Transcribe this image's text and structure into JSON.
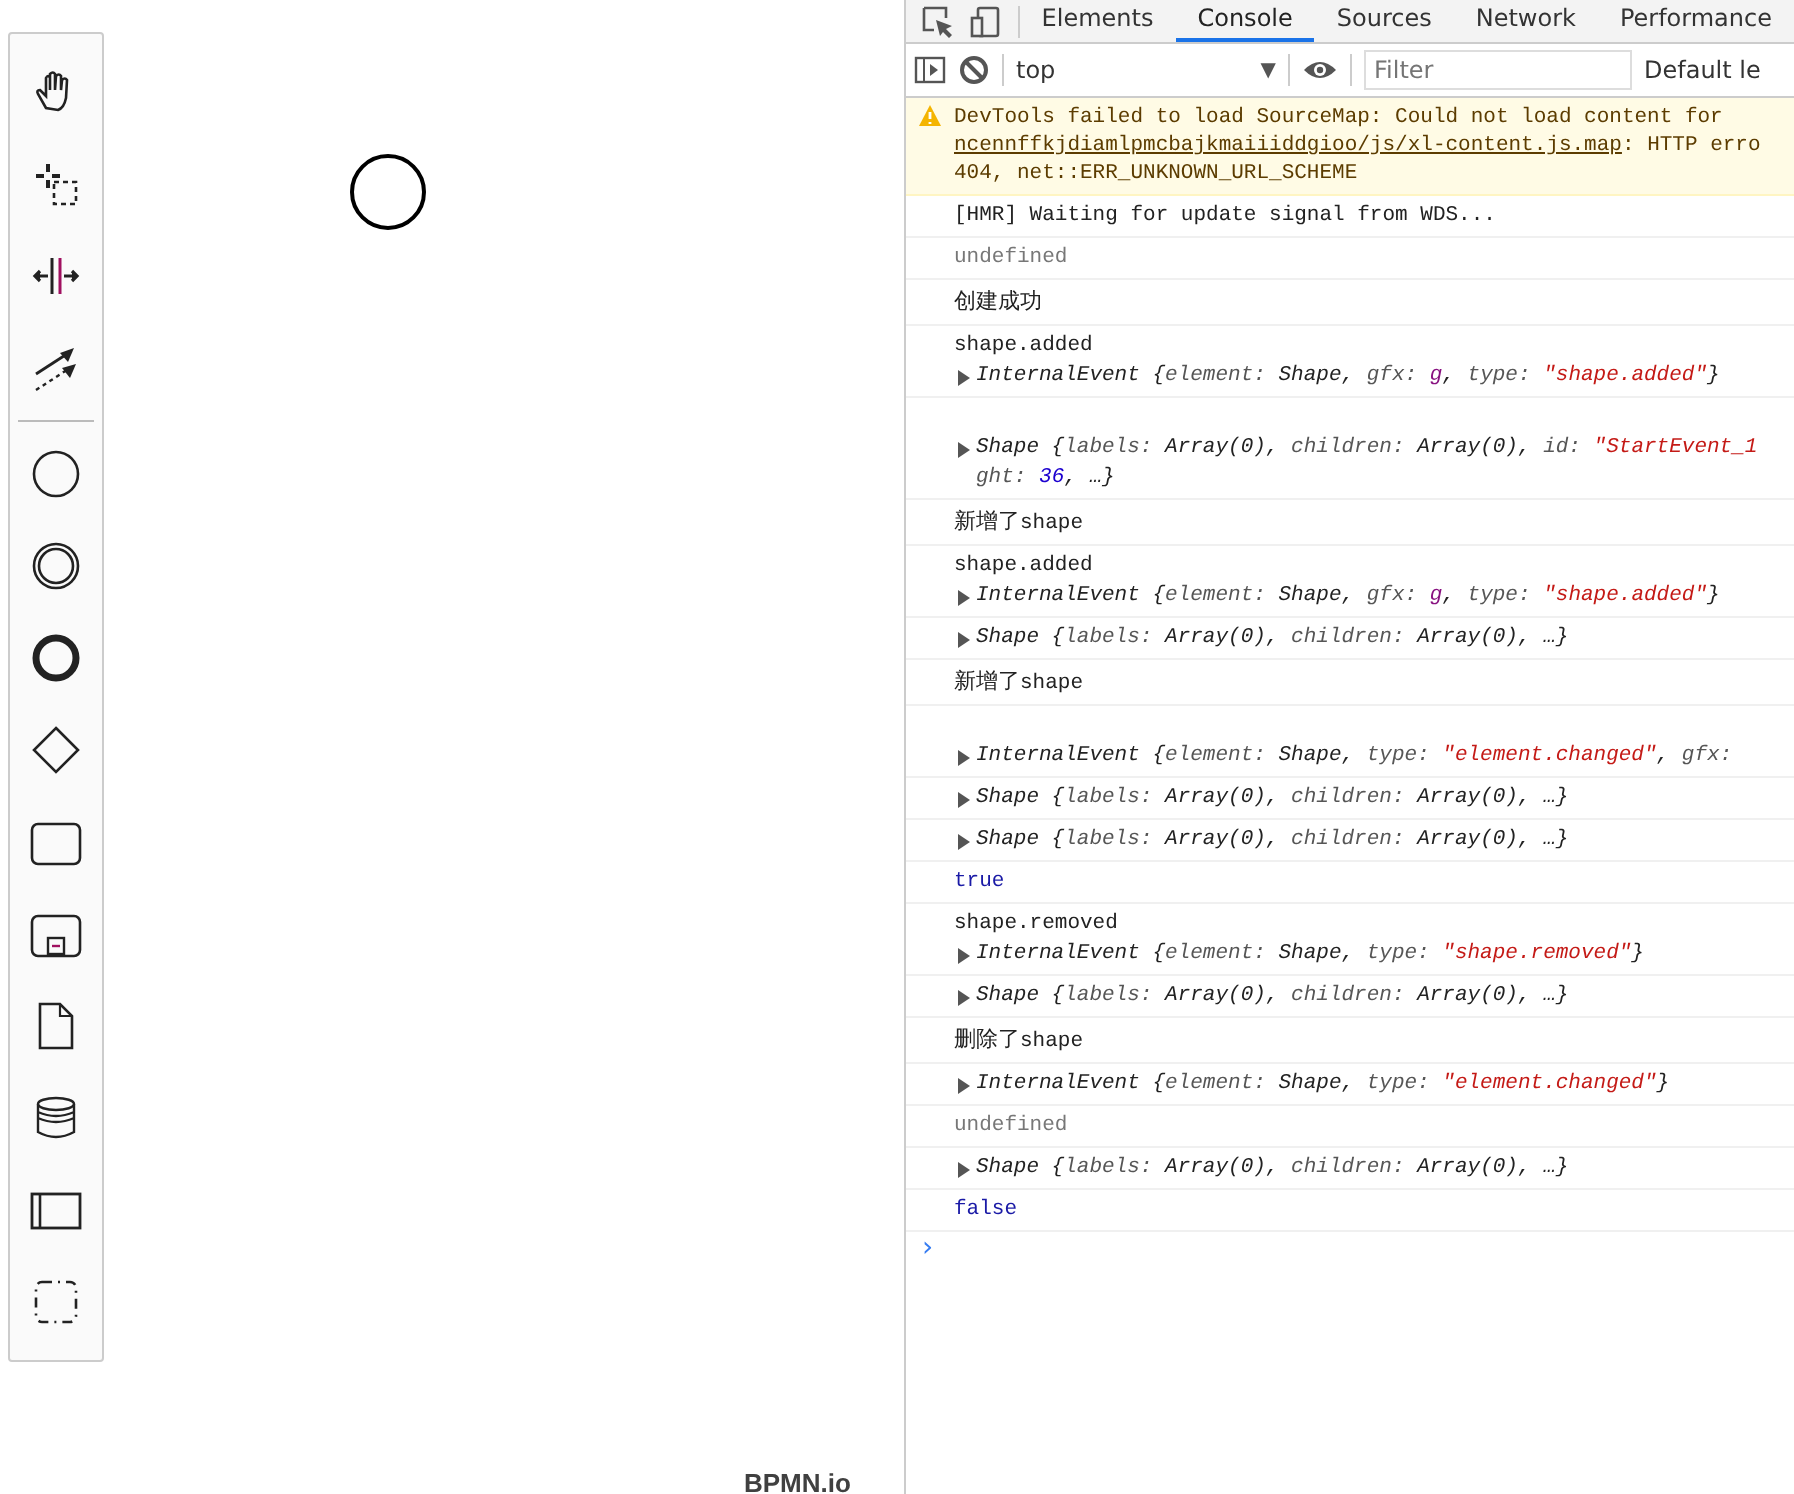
{
  "palette": {
    "tools": [
      {
        "kind": "hand"
      },
      {
        "kind": "lasso"
      },
      {
        "kind": "space"
      },
      {
        "kind": "connect"
      },
      {
        "kind": "separator"
      },
      {
        "kind": "start"
      },
      {
        "kind": "intermediate"
      },
      {
        "kind": "end"
      },
      {
        "kind": "gateway"
      },
      {
        "kind": "task"
      },
      {
        "kind": "subprocess"
      },
      {
        "kind": "data-object"
      },
      {
        "kind": "data-store"
      },
      {
        "kind": "pool"
      },
      {
        "kind": "group"
      }
    ]
  },
  "canvas": {
    "shapes": [
      {
        "kind": "start"
      }
    ],
    "watermark": "BPMN.io"
  },
  "devtools": {
    "tabs": [
      {
        "label": "Elements",
        "selected": false
      },
      {
        "label": "Console",
        "selected": true
      },
      {
        "label": "Sources",
        "selected": false
      },
      {
        "label": "Network",
        "selected": false
      },
      {
        "label": "Performance",
        "selected": false
      }
    ],
    "toolbar": {
      "context": "top",
      "dropdown_glyph": "▼",
      "filter_placeholder": "Filter",
      "levels": "Default le"
    },
    "warning": {
      "lines": [
        [
          {
            "kind": "plain",
            "t": "DevTools failed to load SourceMap: Could not load content for"
          }
        ],
        [
          {
            "kind": "link",
            "t": "ncennffkjdiamlpmcbajkmaiiiddgioo/js/xl-content.js.map"
          },
          {
            "kind": "plain",
            "t": ": HTTP erro"
          }
        ],
        [
          {
            "kind": "plain",
            "t": "404, net::ERR_UNKNOWN_URL_SCHEME"
          }
        ]
      ]
    },
    "messages": [
      {
        "lines": [
          {
            "toggle": false,
            "parts": [
              {
                "kind": "plain",
                "t": "[HMR] Waiting for update signal from WDS..."
              }
            ]
          }
        ]
      },
      {
        "lines": [
          {
            "toggle": false,
            "parts": [
              {
                "kind": "dim",
                "t": "undefined"
              }
            ]
          }
        ]
      },
      {
        "lines": [
          {
            "toggle": false,
            "parts": [
              {
                "kind": "plain",
                "t": "创建成功"
              }
            ]
          }
        ]
      },
      {
        "lines": [
          {
            "toggle": false,
            "parts": [
              {
                "kind": "plain",
                "t": "shape.added"
              }
            ]
          },
          {
            "toggle": true,
            "parts": [
              {
                "kind": "obj",
                "t": "InternalEvent {"
              },
              {
                "kind": "key",
                "t": "element: "
              },
              {
                "kind": "obj",
                "t": "Shape, "
              },
              {
                "kind": "key",
                "t": "gfx: "
              },
              {
                "kind": "sym",
                "t": "g"
              },
              {
                "kind": "obj",
                "t": ", "
              },
              {
                "kind": "key",
                "t": "type: "
              },
              {
                "kind": "str",
                "t": "\"shape.added\""
              },
              {
                "kind": "obj",
                "t": "}"
              }
            ]
          }
        ]
      },
      {
        "spacer": true,
        "lines": [
          {
            "toggle": true,
            "parts": [
              {
                "kind": "obj",
                "t": "Shape {"
              },
              {
                "kind": "key",
                "t": "labels: "
              },
              {
                "kind": "obj",
                "t": "Array(0), "
              },
              {
                "kind": "key",
                "t": "children: "
              },
              {
                "kind": "obj",
                "t": "Array(0), "
              },
              {
                "kind": "key",
                "t": "id: "
              },
              {
                "kind": "str",
                "t": "\"StartEvent_1"
              }
            ]
          },
          {
            "toggle": false,
            "parts": [
              {
                "kind": "key",
                "t": "ght: "
              },
              {
                "kind": "num",
                "t": "36"
              },
              {
                "kind": "obj",
                "t": ", …}"
              }
            ]
          }
        ]
      },
      {
        "lines": [
          {
            "toggle": false,
            "parts": [
              {
                "kind": "plain",
                "t": "新增了shape"
              }
            ]
          }
        ]
      },
      {
        "lines": [
          {
            "toggle": false,
            "parts": [
              {
                "kind": "plain",
                "t": "shape.added"
              }
            ]
          },
          {
            "toggle": true,
            "parts": [
              {
                "kind": "obj",
                "t": "InternalEvent {"
              },
              {
                "kind": "key",
                "t": "element: "
              },
              {
                "kind": "obj",
                "t": "Shape, "
              },
              {
                "kind": "key",
                "t": "gfx: "
              },
              {
                "kind": "sym",
                "t": "g"
              },
              {
                "kind": "obj",
                "t": ", "
              },
              {
                "kind": "key",
                "t": "type: "
              },
              {
                "kind": "str",
                "t": "\"shape.added\""
              },
              {
                "kind": "obj",
                "t": "}"
              }
            ]
          }
        ]
      },
      {
        "lines": [
          {
            "toggle": true,
            "parts": [
              {
                "kind": "obj",
                "t": "Shape {"
              },
              {
                "kind": "key",
                "t": "labels: "
              },
              {
                "kind": "obj",
                "t": "Array(0), "
              },
              {
                "kind": "key",
                "t": "children: "
              },
              {
                "kind": "obj",
                "t": "Array(0), …}"
              }
            ]
          }
        ]
      },
      {
        "lines": [
          {
            "toggle": false,
            "parts": [
              {
                "kind": "plain",
                "t": "新增了shape"
              }
            ]
          }
        ]
      },
      {
        "spacer": true,
        "lines": [
          {
            "toggle": true,
            "parts": [
              {
                "kind": "obj",
                "t": "InternalEvent {"
              },
              {
                "kind": "key",
                "t": "element: "
              },
              {
                "kind": "obj",
                "t": "Shape, "
              },
              {
                "kind": "key",
                "t": "type: "
              },
              {
                "kind": "str",
                "t": "\"element.changed\""
              },
              {
                "kind": "obj",
                "t": ", "
              },
              {
                "kind": "key",
                "t": "gfx:"
              }
            ]
          }
        ]
      },
      {
        "lines": [
          {
            "toggle": true,
            "parts": [
              {
                "kind": "obj",
                "t": "Shape {"
              },
              {
                "kind": "key",
                "t": "labels: "
              },
              {
                "kind": "obj",
                "t": "Array(0), "
              },
              {
                "kind": "key",
                "t": "children: "
              },
              {
                "kind": "obj",
                "t": "Array(0), …}"
              }
            ]
          }
        ]
      },
      {
        "lines": [
          {
            "toggle": true,
            "parts": [
              {
                "kind": "obj",
                "t": "Shape {"
              },
              {
                "kind": "key",
                "t": "labels: "
              },
              {
                "kind": "obj",
                "t": "Array(0), "
              },
              {
                "kind": "key",
                "t": "children: "
              },
              {
                "kind": "obj",
                "t": "Array(0), …}"
              }
            ]
          }
        ]
      },
      {
        "lines": [
          {
            "toggle": false,
            "parts": [
              {
                "kind": "bool",
                "t": "true"
              }
            ]
          }
        ]
      },
      {
        "lines": [
          {
            "toggle": false,
            "parts": [
              {
                "kind": "plain",
                "t": "shape.removed"
              }
            ]
          },
          {
            "toggle": true,
            "parts": [
              {
                "kind": "obj",
                "t": "InternalEvent {"
              },
              {
                "kind": "key",
                "t": "element: "
              },
              {
                "kind": "obj",
                "t": "Shape, "
              },
              {
                "kind": "key",
                "t": "type: "
              },
              {
                "kind": "str",
                "t": "\"shape.removed\""
              },
              {
                "kind": "obj",
                "t": "}"
              }
            ]
          }
        ]
      },
      {
        "lines": [
          {
            "toggle": true,
            "parts": [
              {
                "kind": "obj",
                "t": "Shape {"
              },
              {
                "kind": "key",
                "t": "labels: "
              },
              {
                "kind": "obj",
                "t": "Array(0), "
              },
              {
                "kind": "key",
                "t": "children: "
              },
              {
                "kind": "obj",
                "t": "Array(0), …}"
              }
            ]
          }
        ]
      },
      {
        "lines": [
          {
            "toggle": false,
            "parts": [
              {
                "kind": "plain",
                "t": "删除了shape"
              }
            ]
          }
        ]
      },
      {
        "lines": [
          {
            "toggle": true,
            "parts": [
              {
                "kind": "obj",
                "t": "InternalEvent {"
              },
              {
                "kind": "key",
                "t": "element: "
              },
              {
                "kind": "obj",
                "t": "Shape, "
              },
              {
                "kind": "key",
                "t": "type: "
              },
              {
                "kind": "str",
                "t": "\"element.changed\""
              },
              {
                "kind": "obj",
                "t": "}"
              }
            ]
          }
        ]
      },
      {
        "lines": [
          {
            "toggle": false,
            "parts": [
              {
                "kind": "dim",
                "t": "undefined"
              }
            ]
          }
        ]
      },
      {
        "lines": [
          {
            "toggle": true,
            "parts": [
              {
                "kind": "obj",
                "t": "Shape {"
              },
              {
                "kind": "key",
                "t": "labels: "
              },
              {
                "kind": "obj",
                "t": "Array(0), "
              },
              {
                "kind": "key",
                "t": "children: "
              },
              {
                "kind": "obj",
                "t": "Array(0), …}"
              }
            ]
          }
        ]
      },
      {
        "lines": [
          {
            "toggle": false,
            "parts": [
              {
                "kind": "bool",
                "t": "false"
              }
            ]
          }
        ]
      }
    ],
    "prompt": "›"
  }
}
